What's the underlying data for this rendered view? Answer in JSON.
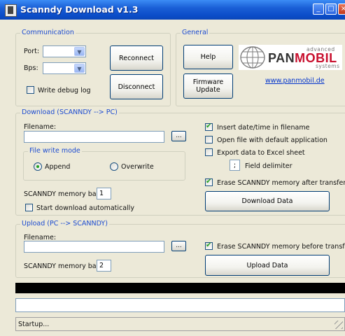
{
  "window": {
    "title": "Scanndy Download v1.3"
  },
  "communication": {
    "legend": "Communication",
    "port_label": "Port:",
    "port_value": "",
    "bps_label": "Bps:",
    "bps_value": "",
    "debug_log_label": "Write debug log",
    "debug_log_checked": false,
    "reconnect_label": "Reconnect",
    "disconnect_label": "Disconnect"
  },
  "general": {
    "legend": "General",
    "help_label": "Help",
    "firmware_label_line1": "Firmware",
    "firmware_label_line2": "Update",
    "logo_advanced": "advanced",
    "logo_pan": "PAN",
    "logo_mobil": "MOBIL",
    "logo_systems": "systems",
    "website_link": "www.panmobil.de"
  },
  "download": {
    "legend": "Download (SCANNDY --> PC)",
    "filename_label": "Filename:",
    "filename_value": "",
    "browse_label": "...",
    "file_write_mode": {
      "legend": "File write mode",
      "append_label": "Append",
      "overwrite_label": "Overwrite",
      "selected": "Append"
    },
    "memory_bank_label": "SCANNDY memory bank:",
    "memory_bank_value": "1",
    "auto_start_label": "Start download automatically",
    "auto_start_checked": false,
    "insert_datetime_label": "Insert date/time in filename",
    "insert_datetime_checked": true,
    "open_file_label": "Open file with default application",
    "open_file_checked": false,
    "export_excel_label": "Export data to Excel sheet",
    "export_excel_checked": false,
    "field_delimiter_value": ";",
    "field_delimiter_label": "Field delimiter",
    "erase_after_label": "Erase SCANNDY memory after transfer",
    "erase_after_checked": true,
    "download_button_label": "Download Data"
  },
  "upload": {
    "legend": "Upload (PC --> SCANNDY)",
    "filename_label": "Filename:",
    "filename_value": "",
    "browse_label": "...",
    "memory_bank_label": "SCANNDY memory bank:",
    "memory_bank_value": "2",
    "erase_before_label": "Erase SCANNDY memory before transfer",
    "erase_before_checked": true,
    "upload_button_label": "Upload Data"
  },
  "status": {
    "text": "Startup..."
  },
  "colors": {
    "title_bar": "#0b4cc8",
    "group_label": "#1c4bd0",
    "check_mark": "#21a121",
    "progress_fill": "#000000"
  }
}
